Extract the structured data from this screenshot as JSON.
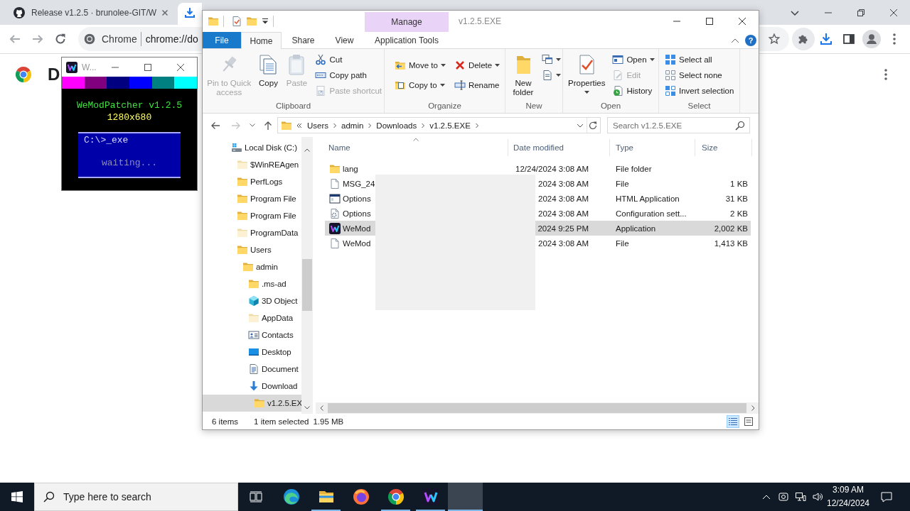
{
  "browser": {
    "tabs": [
      {
        "kind": "site",
        "title": "Release v1.2.5 · brunolee-GIT/W",
        "selected": false
      },
      {
        "kind": "downloads",
        "selected": true
      }
    ],
    "omnibox": {
      "chip": "Chrome",
      "url": "chrome://do"
    },
    "page": {
      "heading": "D"
    }
  },
  "patcher": {
    "title": "W...",
    "stripes": [
      {
        "color": "#ff00ff"
      },
      {
        "color": "#800080"
      },
      {
        "color": "#000080"
      },
      {
        "color": "#0000ff"
      },
      {
        "color": "#008080"
      },
      {
        "color": "#00ffff"
      }
    ],
    "heading": "WeModPatcher v1.2.5",
    "resolution": "1280x680",
    "console": {
      "prompt": "C:\\>_exe",
      "status": "waiting..."
    }
  },
  "explorer": {
    "context_tab": "Manage",
    "title": "v1.2.5.EXE",
    "help": "?",
    "ribbon_tabs": [
      {
        "label": "File",
        "kind": "backstage",
        "selected": false
      },
      {
        "label": "Home",
        "kind": "tab",
        "selected": true
      },
      {
        "label": "Share",
        "kind": "tab",
        "selected": false
      },
      {
        "label": "View",
        "kind": "tab",
        "selected": false
      },
      {
        "label": "Application Tools",
        "kind": "contextual",
        "selected": false
      }
    ],
    "ribbon_groups": [
      {
        "label": "Clipboard",
        "commands": [
          {
            "label": "Pin to Quick access",
            "kind": "large",
            "dropdown": false,
            "disabled": true
          },
          {
            "label": "Copy",
            "kind": "large",
            "dropdown": false,
            "disabled": false
          },
          {
            "label": "Paste",
            "kind": "large",
            "dropdown": false,
            "disabled": true
          },
          {
            "label": "Cut",
            "kind": "small",
            "dropdown": false,
            "disabled": false
          },
          {
            "label": "Copy path",
            "kind": "small",
            "dropdown": false,
            "disabled": false
          },
          {
            "label": "Paste shortcut",
            "kind": "small",
            "dropdown": false,
            "disabled": true
          }
        ]
      },
      {
        "label": "Organize",
        "commands": [
          {
            "label": "Move to",
            "kind": "small",
            "dropdown": true,
            "disabled": false
          },
          {
            "label": "Copy to",
            "kind": "small",
            "dropdown": true,
            "disabled": false
          },
          {
            "label": "Delete",
            "kind": "small",
            "dropdown": true,
            "disabled": false
          },
          {
            "label": "Rename",
            "kind": "small",
            "dropdown": false,
            "disabled": false
          }
        ]
      },
      {
        "label": "New",
        "commands": [
          {
            "label": "New folder",
            "kind": "large",
            "dropdown": false,
            "disabled": false
          },
          {
            "kind": "icon",
            "dropdown": true,
            "disabled": false
          },
          {
            "kind": "icon",
            "dropdown": true,
            "disabled": false
          }
        ]
      },
      {
        "label": "Open",
        "commands": [
          {
            "label": "Properties",
            "kind": "large",
            "dropdown": true,
            "disabled": false
          },
          {
            "label": "Open",
            "kind": "small",
            "dropdown": true,
            "disabled": false
          },
          {
            "label": "Edit",
            "kind": "small",
            "dropdown": false,
            "disabled": true
          },
          {
            "label": "History",
            "kind": "small",
            "dropdown": false,
            "disabled": false
          }
        ]
      },
      {
        "label": "Select",
        "commands": [
          {
            "label": "Select all",
            "kind": "small",
            "dropdown": false,
            "disabled": false
          },
          {
            "label": "Select none",
            "kind": "small",
            "dropdown": false,
            "disabled": false
          },
          {
            "label": "Invert selection",
            "kind": "small",
            "dropdown": false,
            "disabled": false
          }
        ]
      }
    ],
    "address": [
      "Users",
      "admin",
      "Downloads",
      "v1.2.5.EXE"
    ],
    "search": {
      "placeholder": "Search v1.2.5.EXE"
    },
    "nav": [
      {
        "kind": "drive",
        "label": "Local Disk (C:)",
        "hidden": false,
        "selected": false,
        "children": [
          {
            "kind": "folder",
            "label": "$WinREAgen",
            "hidden": true,
            "selected": false
          },
          {
            "kind": "folder",
            "label": "PerfLogs",
            "hidden": false,
            "selected": false
          },
          {
            "kind": "folder",
            "label": "Program File",
            "hidden": false,
            "selected": false
          },
          {
            "kind": "folder",
            "label": "Program File",
            "hidden": false,
            "selected": false
          },
          {
            "kind": "folder",
            "label": "ProgramData",
            "hidden": true,
            "selected": false
          },
          {
            "kind": "folder",
            "label": "Users",
            "hidden": false,
            "selected": false,
            "children": [
              {
                "kind": "folder",
                "label": "admin",
                "hidden": false,
                "selected": false,
                "children": [
                  {
                    "kind": "folder",
                    "label": ".ms-ad",
                    "hidden": false,
                    "selected": false
                  },
                  {
                    "kind": "objects",
                    "label": "3D Object",
                    "hidden": false,
                    "selected": false
                  },
                  {
                    "kind": "folder",
                    "label": "AppData",
                    "hidden": true,
                    "selected": false
                  },
                  {
                    "kind": "contacts",
                    "label": "Contacts",
                    "hidden": false,
                    "selected": false
                  },
                  {
                    "kind": "desktop",
                    "label": "Desktop",
                    "hidden": false,
                    "selected": false
                  },
                  {
                    "kind": "documents",
                    "label": "Document",
                    "hidden": false,
                    "selected": false
                  },
                  {
                    "kind": "downloads",
                    "label": "Download",
                    "hidden": false,
                    "selected": false,
                    "children": [
                      {
                        "kind": "folder",
                        "label": "v1.2.5.EX",
                        "hidden": false,
                        "selected": true
                      }
                    ]
                  }
                ]
              }
            ]
          }
        ]
      }
    ],
    "columns": [
      {
        "label": "Name",
        "sorted": true
      },
      {
        "label": "Date modified",
        "sorted": false
      },
      {
        "label": "Type",
        "sorted": false
      },
      {
        "label": "Size",
        "sorted": false
      }
    ],
    "rows": [
      {
        "kind": "folder",
        "name": "lang",
        "date": "12/24/2024 3:08 AM",
        "type": "File folder",
        "selected": false
      },
      {
        "kind": "file",
        "name": "MSG_24",
        "date": "2024 3:08 AM",
        "type": "File",
        "size": "1 KB",
        "selected": false
      },
      {
        "kind": "hta",
        "name": "Options",
        "date": "2024 3:08 AM",
        "type": "HTML Application",
        "size": "31 KB",
        "selected": false
      },
      {
        "kind": "config",
        "name": "Options",
        "date": "2024 3:08 AM",
        "type": "Configuration sett...",
        "size": "2 KB",
        "selected": false
      },
      {
        "kind": "app",
        "name": "WeMod",
        "date": "2024 9:25 PM",
        "type": "Application",
        "size": "2,002 KB",
        "selected": true
      },
      {
        "kind": "file",
        "name": "WeMod",
        "date": "2024 3:08 AM",
        "type": "File",
        "size": "1,413 KB",
        "selected": false
      }
    ],
    "status": {
      "count": "6 items",
      "selection": "1 item selected",
      "size": "1.95 MB"
    },
    "views": [
      {
        "kind": "details",
        "selected": true
      },
      {
        "kind": "tiles",
        "selected": false
      }
    ]
  },
  "taskbar": {
    "search": {
      "placeholder": "Type here to search"
    },
    "apps": [
      {
        "kind": "edge",
        "running": false,
        "active": false
      },
      {
        "kind": "explorer",
        "running": true,
        "active": false
      },
      {
        "kind": "firefox",
        "running": false,
        "active": false
      },
      {
        "kind": "chrome",
        "running": true,
        "active": false
      },
      {
        "kind": "wemod",
        "running": true,
        "active": false
      },
      {
        "kind": "blank",
        "running": true,
        "active": true
      }
    ],
    "clock": {
      "time": "3:09 AM",
      "date": "12/24/2024"
    }
  }
}
